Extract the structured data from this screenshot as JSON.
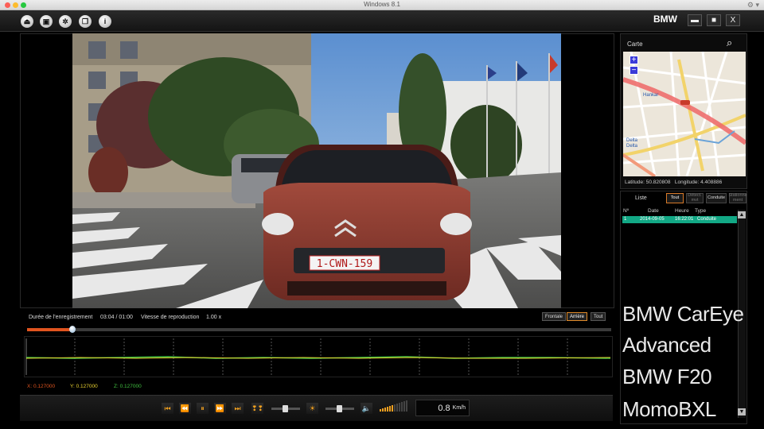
{
  "window": {
    "title": "Windows 8.1"
  },
  "toolbar": {
    "buttons": [
      "eject-icon",
      "camera-icon",
      "settings-icon",
      "copy-icon",
      "info-icon"
    ],
    "brand": "BMW",
    "minimize": "▬",
    "maximize": "■",
    "close": "X"
  },
  "map": {
    "title": "Carte",
    "zoom_in": "+",
    "zoom_out": "−",
    "latitude_label": "Latitude:",
    "latitude": "50.820808",
    "longitude_label": "Longitude:",
    "longitude": "4.408886",
    "street_labels": [
      "Hankar",
      "Delta",
      "Delta"
    ]
  },
  "list": {
    "title": "Liste",
    "filters": [
      {
        "label": "Tout",
        "state": "active"
      },
      {
        "label": "Détect. mvt",
        "state": "dim"
      },
      {
        "label": "Conduite",
        "state": "normal"
      },
      {
        "label": "Stationne ment",
        "state": "dim"
      }
    ],
    "columns": [
      "Nº",
      "Date",
      "Heure",
      "Type"
    ],
    "rows": [
      {
        "no": "1",
        "date": "2014-09-05",
        "time": "16:22:01",
        "type": "Conduite"
      }
    ]
  },
  "overlay": {
    "lines": [
      "BMW CarEye",
      "Advanced",
      "BMW F20",
      "MomoBXL"
    ]
  },
  "info": {
    "duration_label": "Durée de l'enregistrement",
    "current": "03:04",
    "sep": "/",
    "total": "01:00",
    "speed_label": "Vitesse de reproduction",
    "speed": "1.00 x",
    "views": [
      {
        "label": "Frontale",
        "active": false
      },
      {
        "label": "Arrière",
        "active": true
      },
      {
        "label": "Tout",
        "active": false
      }
    ]
  },
  "progress": {
    "fraction": 0.077
  },
  "gsensor": {
    "x_label": "X:",
    "x": "0.127000",
    "y_label": "Y:",
    "y": "0.127000",
    "z_label": "Z:",
    "z": "0.127000",
    "colors": {
      "x": "#e0541f",
      "y": "#e8d030",
      "z": "#40c040"
    }
  },
  "controls": {
    "speed_value": "0.8",
    "speed_unit": "Km/h",
    "icons": [
      "first-icon",
      "rewind-icon",
      "pause-icon",
      "fast-forward-icon",
      "last-icon",
      "footsteps-icon",
      "brightness-icon",
      "volume-icon"
    ]
  },
  "colors": {
    "accent": "#e0541f",
    "selection": "#12a885",
    "control_icon": "#f0a020"
  }
}
